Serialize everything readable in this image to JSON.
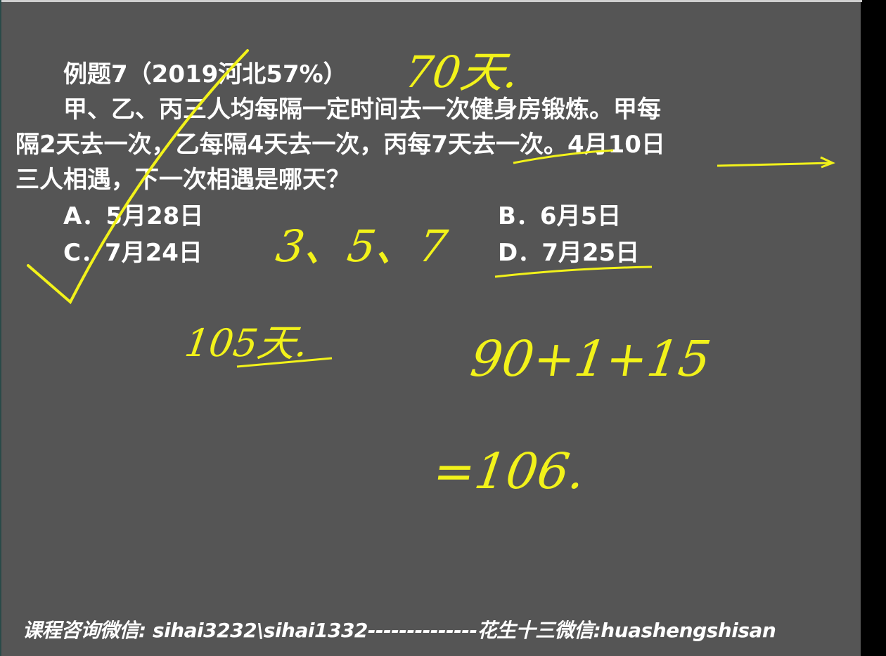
{
  "problem": {
    "title": "例题7（2019河北57%）",
    "line1": "甲、乙、丙三人均每隔一定时间去一次健身房锻炼。甲每",
    "line2": "隔2天去一次，乙每隔4天去一次，丙每7天去一次。4月10日",
    "line3": "三人相遇，下一次相遇是哪天？",
    "options": [
      {
        "label": "A．5月28日"
      },
      {
        "label": "B．6月5日"
      },
      {
        "label": "C．7月24日"
      },
      {
        "label": "D．7月25日"
      }
    ]
  },
  "handwriting": {
    "note_top": "70天.",
    "intervals": "3、5、7",
    "lcm": "105天.",
    "sum": "90+1+15",
    "result": "=106."
  },
  "footer": "课程咨询微信: sihai3232\\sihai1332--------------花生十三微信:huashengshisan",
  "colors": {
    "background": "#555555",
    "text": "#ffffff",
    "ink": "#f2f21a"
  }
}
